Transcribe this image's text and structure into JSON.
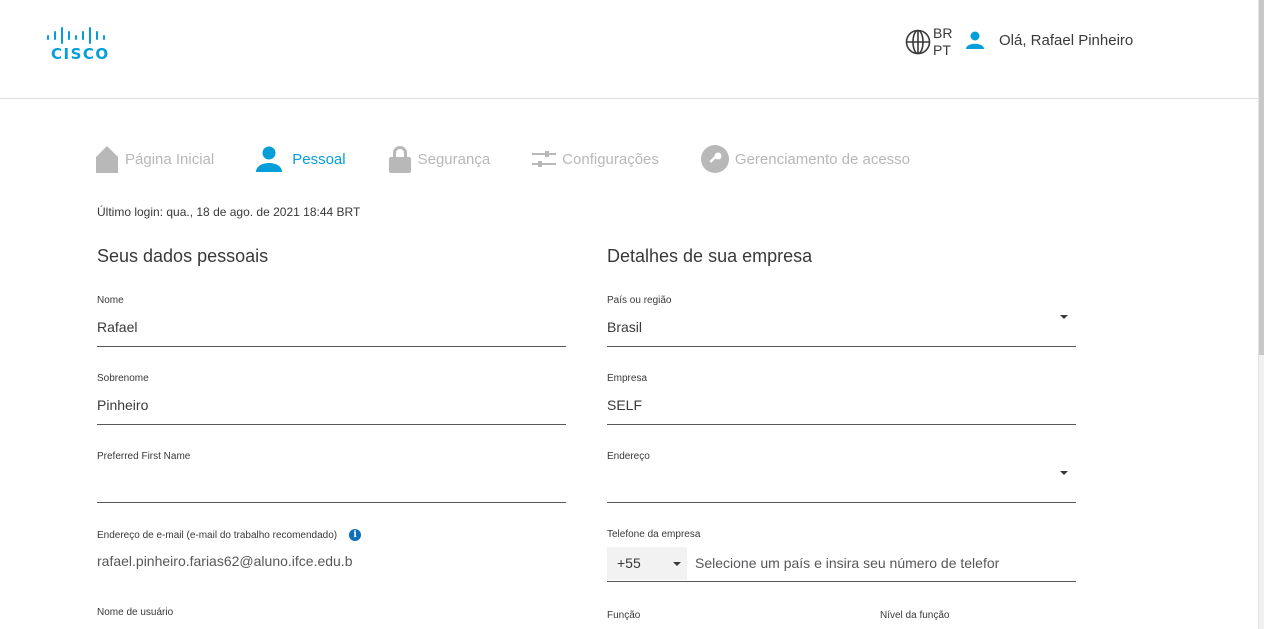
{
  "header": {
    "logo_text": "CISCO",
    "lang_top": "BR",
    "lang_bottom": "PT",
    "greeting": "Olá, Rafael Pinheiro"
  },
  "tabs": [
    {
      "label": "Página Inicial",
      "icon": "home-icon",
      "active": false
    },
    {
      "label": "Pessoal",
      "icon": "person-icon",
      "active": true
    },
    {
      "label": "Segurança",
      "icon": "lock-icon",
      "active": false
    },
    {
      "label": "Configurações",
      "icon": "sliders-icon",
      "active": false
    },
    {
      "label": "Gerenciamento de acesso",
      "icon": "key-icon",
      "active": false
    }
  ],
  "last_login": "Último login: qua., 18 de ago. de 2021 18:44 BRT",
  "personal": {
    "title": "Seus dados pessoais",
    "first_name": {
      "label": "Nome",
      "value": "Rafael"
    },
    "last_name": {
      "label": "Sobrenome",
      "value": "Pinheiro"
    },
    "preferred_name": {
      "label": "Preferred First Name",
      "value": ""
    },
    "email": {
      "label": "Endereço de e-mail (e-mail do trabalho recomendado)",
      "value": "rafael.pinheiro.farias62@aluno.ifce.edu.b"
    },
    "username": {
      "label": "Nome de usuário"
    }
  },
  "company": {
    "title": "Detalhes de sua empresa",
    "country": {
      "label": "País ou região",
      "value": "Brasil"
    },
    "company": {
      "label": "Empresa",
      "value": "SELF"
    },
    "address": {
      "label": "Endereço",
      "value": ""
    },
    "phone": {
      "label": "Telefone da empresa",
      "prefix": "+55",
      "placeholder": "Selecione um país e insira seu número de telefor"
    },
    "role": {
      "label": "Função"
    },
    "role_level": {
      "label": "Nível da função"
    }
  },
  "colors": {
    "accent": "#049fd9",
    "inactive_tab": "#b8b8b8",
    "text": "#39393b",
    "info": "#0d6fb5"
  }
}
